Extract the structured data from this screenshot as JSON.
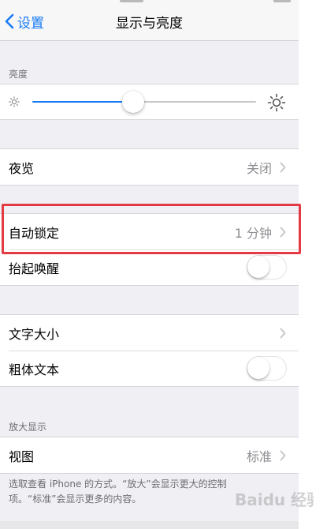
{
  "nav": {
    "back_label": "设置",
    "title": "显示与亮度"
  },
  "brightness": {
    "header": "亮度",
    "level": 0.45
  },
  "night_shift": {
    "label": "夜览",
    "value": "关闭"
  },
  "auto_lock": {
    "label": "自动锁定",
    "value": "1 分钟"
  },
  "raise_to_wake": {
    "label": "抬起唤醒",
    "on": false
  },
  "text_size": {
    "label": "文字大小"
  },
  "bold_text": {
    "label": "粗体文本",
    "on": false
  },
  "zoom": {
    "header": "放大显示",
    "view_label": "视图",
    "view_value": "标准",
    "footer": "选取查看 iPhone 的方式。“放大”会显示更大的控制项。“标准”会显示更多的内容。"
  },
  "watermark": {
    "text": "Baidu 经验"
  },
  "colors": {
    "accent": "#1a7cf5",
    "highlight": "#e33a43",
    "background": "#efeff4",
    "secondary_text": "#8e8e93"
  }
}
